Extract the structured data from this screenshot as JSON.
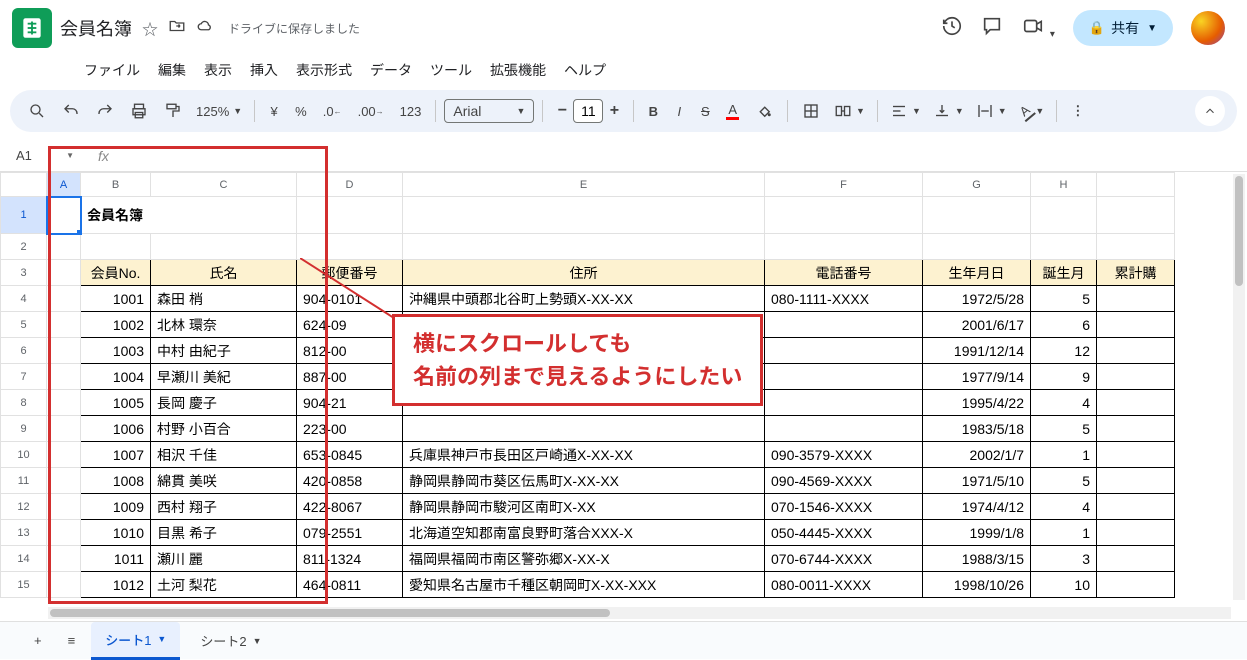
{
  "header": {
    "doc_title": "会員名簿",
    "drive_status": "ドライブに保存しました",
    "share_label": "共有"
  },
  "menubar": [
    "ファイル",
    "編集",
    "表示",
    "挿入",
    "表示形式",
    "データ",
    "ツール",
    "拡張機能",
    "ヘルプ"
  ],
  "toolbar": {
    "zoom": "125%",
    "num_fmt": "123",
    "font": "Arial",
    "font_size": "11"
  },
  "namebox": {
    "cell": "A1",
    "fx": ""
  },
  "columns": [
    "A",
    "B",
    "C",
    "D",
    "E",
    "F",
    "G",
    "H"
  ],
  "title_cell": "会員名簿",
  "col_I_partial": "累計購",
  "table": {
    "headers": [
      "会員No.",
      "氏名",
      "郵便番号",
      "住所",
      "電話番号",
      "生年月日",
      "誕生月"
    ],
    "rows": [
      {
        "no": "1001",
        "name": "森田 梢",
        "zip": "904-0101",
        "addr": "沖縄県中頭郡北谷町上勢頭X-XX-XX",
        "tel": "080-1111-XXXX",
        "dob": "1972/5/28",
        "bm": "5"
      },
      {
        "no": "1002",
        "name": "北林 環奈",
        "zip": "624-09",
        "addr": "",
        "tel": "",
        "dob": "2001/6/17",
        "bm": "6"
      },
      {
        "no": "1003",
        "name": "中村 由紀子",
        "zip": "812-00",
        "addr": "",
        "tel": "",
        "dob": "1991/12/14",
        "bm": "12"
      },
      {
        "no": "1004",
        "name": "早瀬川 美紀",
        "zip": "887-00",
        "addr": "",
        "tel": "",
        "dob": "1977/9/14",
        "bm": "9"
      },
      {
        "no": "1005",
        "name": "長岡 慶子",
        "zip": "904-21",
        "addr": "",
        "tel": "",
        "dob": "1995/4/22",
        "bm": "4"
      },
      {
        "no": "1006",
        "name": "村野 小百合",
        "zip": "223-00",
        "addr": "",
        "tel": "",
        "dob": "1983/5/18",
        "bm": "5"
      },
      {
        "no": "1007",
        "name": "相沢 千佳",
        "zip": "653-0845",
        "addr": "兵庫県神戸市長田区戸崎通X-XX-XX",
        "tel": "090-3579-XXXX",
        "dob": "2002/1/7",
        "bm": "1"
      },
      {
        "no": "1008",
        "name": "綿貫 美咲",
        "zip": "420-0858",
        "addr": "静岡県静岡市葵区伝馬町X-XX-XX",
        "tel": "090-4569-XXXX",
        "dob": "1971/5/10",
        "bm": "5"
      },
      {
        "no": "1009",
        "name": "西村 翔子",
        "zip": "422-8067",
        "addr": "静岡県静岡市駿河区南町X-XX",
        "tel": "070-1546-XXXX",
        "dob": "1974/4/12",
        "bm": "4"
      },
      {
        "no": "1010",
        "name": "目黒 希子",
        "zip": "079-2551",
        "addr": "北海道空知郡南富良野町落合XXX-X",
        "tel": "050-4445-XXXX",
        "dob": "1999/1/8",
        "bm": "1"
      },
      {
        "no": "1011",
        "name": "瀬川 麗",
        "zip": "811-1324",
        "addr": "福岡県福岡市南区警弥郷X-XX-X",
        "tel": "070-6744-XXXX",
        "dob": "1988/3/15",
        "bm": "3"
      },
      {
        "no": "1012",
        "name": "土河 梨花",
        "zip": "464-0811",
        "addr": "愛知県名古屋市千種区朝岡町X-XX-XXX",
        "tel": "080-0011-XXXX",
        "dob": "1998/10/26",
        "bm": "10"
      }
    ]
  },
  "annotation": {
    "line1": "横にスクロールしても",
    "line2": "名前の列まで見えるようにしたい"
  },
  "sheet_tabs": {
    "active": "シート1",
    "other": "シート2"
  }
}
